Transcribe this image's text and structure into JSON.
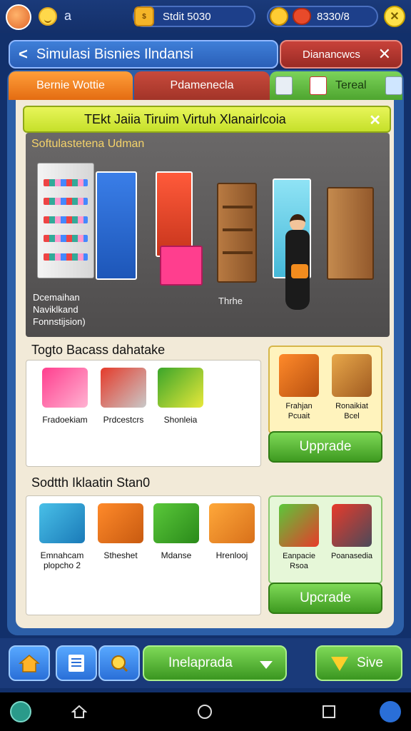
{
  "status": {
    "letter": "a",
    "currency_label": "Stdit 5030",
    "gems_label": "8330/8"
  },
  "header": {
    "title": "Simulasi Bisnies Ilndansi",
    "right_button": "Dianancwcs"
  },
  "tabs": [
    {
      "label": "Bernie Wottie"
    },
    {
      "label": "Pdamenecla"
    },
    {
      "label": "Tereal"
    }
  ],
  "banner": {
    "text": "TEkt Jaiia Tiruim Virtuh Xlanairlcoia"
  },
  "scene": {
    "title": "Softulastetena Udman",
    "note": "Dcemaihan Naviklkand Fonnstijsion)",
    "label": "Thrhe"
  },
  "section1": {
    "title": "Togto Bacass dahatake",
    "items": [
      {
        "label": "Fradoekiam",
        "icon": "shopping-cart-icon"
      },
      {
        "label": "Prdcestcrs",
        "icon": "cart-icon"
      },
      {
        "label": "Shonleia",
        "icon": "box-icon"
      }
    ],
    "side_items": [
      {
        "label": "Frahjan Pcuait",
        "icon": "basket-icon"
      },
      {
        "label": "Ronaikiat Bcel",
        "icon": "crate-icon"
      }
    ],
    "upgrade_label": "Upprade"
  },
  "section2": {
    "title": "Sodtth Iklaatin Stan0",
    "items": [
      {
        "label": "Emnahcam plopcho 2",
        "icon": "cart-icon"
      },
      {
        "label": "Stheshet",
        "icon": "basket-icon"
      },
      {
        "label": "Mdanse",
        "icon": "box-icon"
      },
      {
        "label": "Hrenlooj",
        "icon": "box-icon"
      }
    ],
    "side_items": [
      {
        "label": "Eanpacie Rsoa",
        "icon": "bag-icon"
      },
      {
        "label": "Poanasedia",
        "icon": "crate-icon"
      }
    ],
    "upgrade_label": "Upcrade"
  },
  "bottom": {
    "dropdown_label": "Inelaprada",
    "save_label": "Sive"
  },
  "colors": {
    "background": "#12306b",
    "accent_green": "#4ea52f",
    "accent_orange": "#e46c12",
    "panel": "#f2ead8"
  }
}
